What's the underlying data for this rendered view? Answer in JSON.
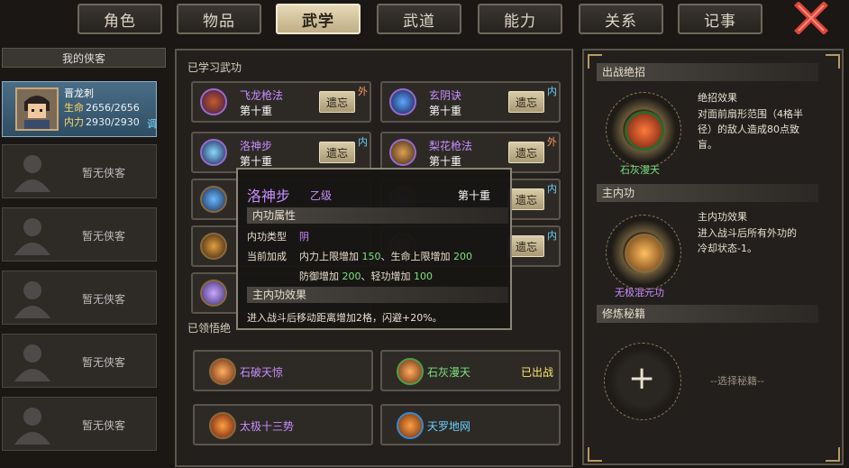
{
  "tabs": [
    "角色",
    "物品",
    "武学",
    "武道",
    "能力",
    "关系",
    "记事"
  ],
  "active_tab": "武学",
  "left_panel": {
    "header": "我的侠客",
    "hero": {
      "name": "晋龙刺",
      "hp_label": "生命",
      "hp_value": "2656/2656",
      "mp_label": "内力",
      "mp_value": "2930/2930",
      "action": "调"
    },
    "empty_slot_label": "暂无侠客",
    "empty_slots": [
      "暂无侠客",
      "暂无侠客",
      "暂无侠客",
      "暂无侠客",
      "暂无侠客"
    ]
  },
  "learned": {
    "title": "已学习武功",
    "forget_label": "遗忘",
    "skills": [
      {
        "name": "飞龙枪法",
        "level": "第十重",
        "tag": "外",
        "tag_type": "wai",
        "icon": "dragon-spear-icon"
      },
      {
        "name": "玄阴诀",
        "level": "第十重",
        "tag": "内",
        "tag_type": "nei",
        "icon": "dark-yin-icon"
      },
      {
        "name": "洛神步",
        "level": "第十重",
        "tag": "内",
        "tag_type": "nei",
        "icon": "lightning-step-icon"
      },
      {
        "name": "梨花枪法",
        "level": "第十重",
        "tag": "外",
        "tag_type": "wai",
        "icon": "pear-spear-icon"
      },
      {
        "name": "",
        "level": "",
        "tag": "",
        "tag_type": "",
        "icon": "blade-icon"
      },
      {
        "name": "",
        "level": "",
        "tag": "内",
        "tag_type": "nei",
        "icon": "purple-wave-icon"
      },
      {
        "name": "",
        "level": "",
        "tag": "",
        "tag_type": "",
        "icon": "golden-pillar-icon"
      },
      {
        "name": "",
        "level": "",
        "tag": "内",
        "tag_type": "nei",
        "icon": "inner-icon"
      },
      {
        "name": "",
        "level": "",
        "tag": "",
        "tag_type": "",
        "icon": "purple-lotus-icon"
      }
    ]
  },
  "ultimates": {
    "title": "已领悟绝",
    "items": [
      {
        "name": "石破天惊",
        "status": "",
        "color": "#c98dff",
        "icon": "stone-break-icon"
      },
      {
        "name": "石灰漫天",
        "status": "已出战",
        "color": "#7ee07e",
        "icon": "lime-sky-icon"
      },
      {
        "name": "太极十三势",
        "status": "",
        "color": "#c98dff",
        "icon": "taiji-icon"
      },
      {
        "name": "天罗地网",
        "status": "",
        "color": "#6ccfff",
        "icon": "heaven-net-icon"
      }
    ]
  },
  "tooltip": {
    "name": "洛神步",
    "grade": "乙级",
    "level": "第十重",
    "section1": "内功属性",
    "type_label": "内功类型",
    "type_value": "阴",
    "bonus_label": "当前加成",
    "bonus_line1_a": "内力上限增加",
    "bonus_line1_b": "150",
    "bonus_line1_c": "、生命上限增加",
    "bonus_line1_d": "200",
    "bonus_line2_a": "防御增加",
    "bonus_line2_b": "200",
    "bonus_line2_c": "、轻功增加",
    "bonus_line2_d": "100",
    "section2": "主内功效果",
    "effect": "进入战斗后移动距离增加2格，闪避+20%。"
  },
  "right_panel": {
    "combat_title": "出战绝招",
    "ult_effect_title": "绝招效果",
    "ult_effect_lines": [
      "对面前扇形范围（4格半",
      "径）的敌人造成80点致",
      "盲。"
    ],
    "ult_name": "石灰漫天",
    "main_title": "主内功",
    "main_effect_title": "主内功效果",
    "main_effect_lines": [
      "进入战斗后所有外功的",
      "冷却状态-1。"
    ],
    "main_name": "无极混元功",
    "cultivate_title": "修炼秘籍",
    "select_label": "--选择秘籍--",
    "add_symbol": "+"
  },
  "colors": {
    "accent_gold": "#b89a62",
    "purple_name": "#c98dff",
    "green_value": "#7ee07e"
  }
}
